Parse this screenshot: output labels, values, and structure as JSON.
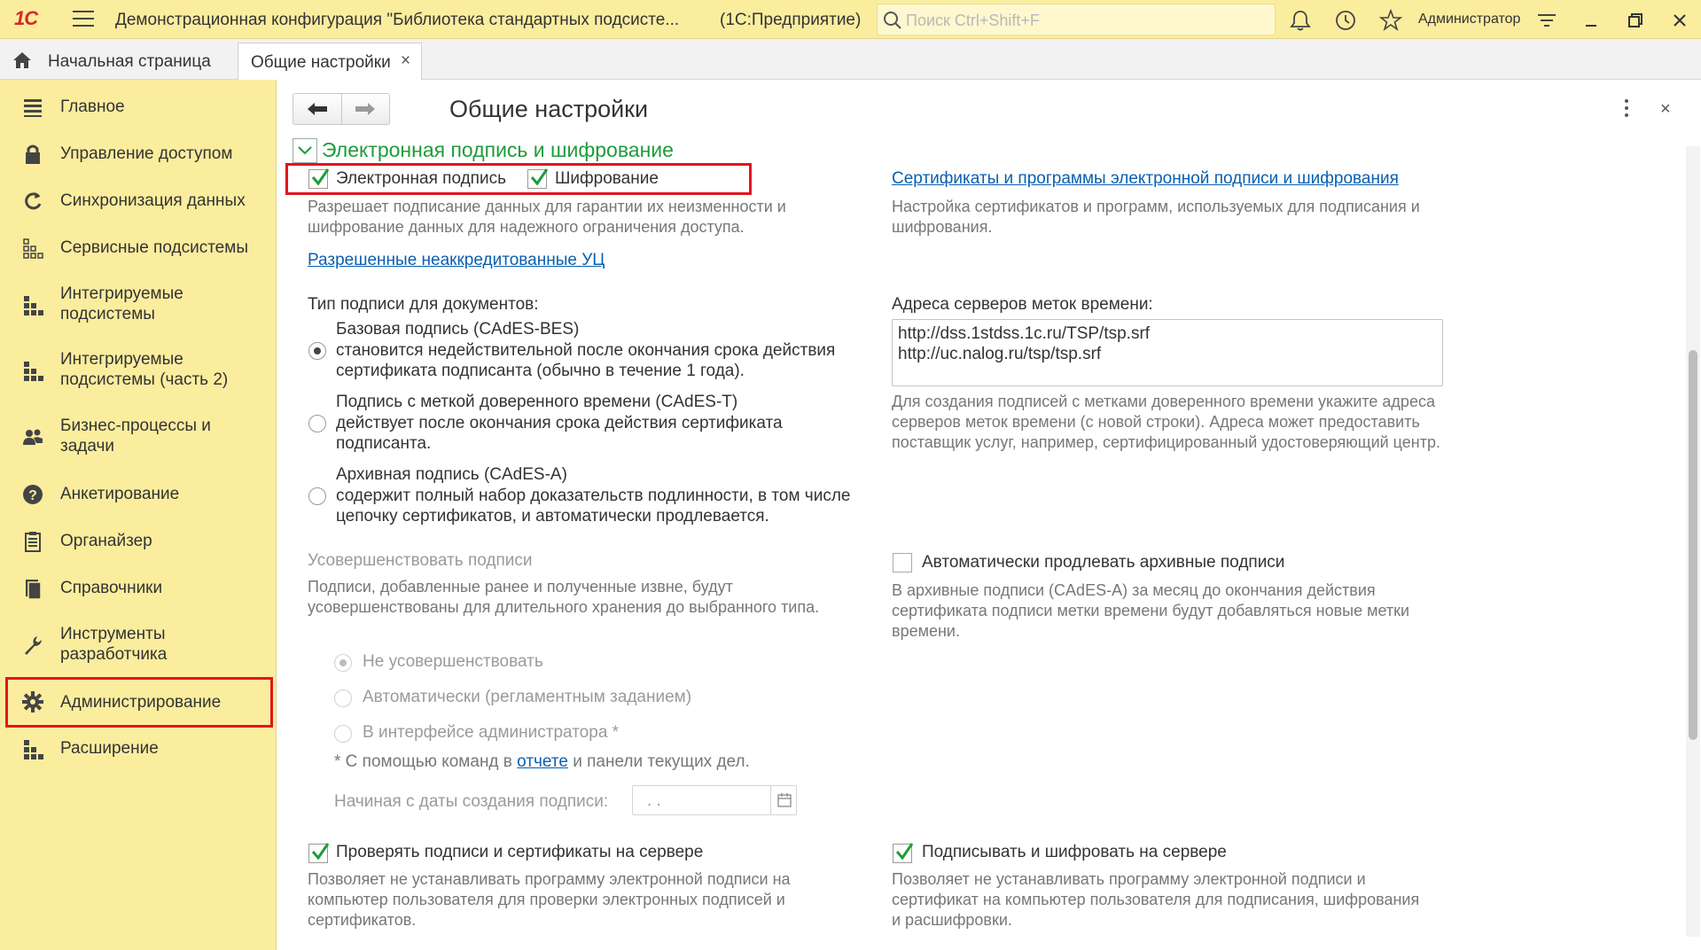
{
  "titlebar": {
    "logo": "1С",
    "title": "Демонстрационная конфигурация \"Библиотека стандартных подсисте...",
    "mode": "(1С:Предприятие)",
    "search_placeholder": "Поиск Ctrl+Shift+F",
    "user": "Администратор"
  },
  "tabs": {
    "home": "Начальная страница",
    "active": "Общие настройки",
    "close_glyph": "×"
  },
  "sidebar": {
    "items": [
      {
        "label": "Главное",
        "icon": "menu-lines-icon"
      },
      {
        "label": "Управление доступом",
        "icon": "lock-icon"
      },
      {
        "label": "Синхронизация данных",
        "icon": "sync-icon"
      },
      {
        "label": "Сервисные подсистемы",
        "icon": "grid-dots-icon"
      },
      {
        "label": "Интегрируемые подсистемы",
        "icon": "blocks-icon"
      },
      {
        "label": "Интегрируемые подсистемы (часть 2)",
        "icon": "blocks-icon"
      },
      {
        "label": "Бизнес-процессы и задачи",
        "icon": "users-icon"
      },
      {
        "label": "Анкетирование",
        "icon": "question-icon"
      },
      {
        "label": "Органайзер",
        "icon": "notepad-icon"
      },
      {
        "label": "Справочники",
        "icon": "books-icon"
      },
      {
        "label": "Инструменты разработчика",
        "icon": "wrench-icon"
      },
      {
        "label": "Администрирование",
        "icon": "gear-icon",
        "active": true
      },
      {
        "label": "Расширение",
        "icon": "blocks-icon"
      }
    ]
  },
  "form": {
    "title": "Общие настройки",
    "group_title": "Электронная подпись и шифрование",
    "cb_signature": "Электронная подпись",
    "cb_encryption": "Шифрование",
    "hint_signature": "Разрешает подписание данных для гарантии их неизменности и шифрование данных для надежного ограничения доступа.",
    "link_ca": "Разрешенные неаккредитованные УЦ",
    "link_certs": "Сертификаты и программы электронной подписи и шифрования",
    "hint_certs": "Настройка сертификатов и программ, используемых для подписания и шифрования.",
    "sig_type_label": "Тип подписи для документов:",
    "sig_types": [
      {
        "title": "Базовая подпись (CAdES-BES)",
        "desc": "становится недействительной после окончания срока действия сертификата подписанта (обычно в течение 1 года).",
        "selected": true
      },
      {
        "title": "Подпись с меткой доверенного времени (CAdES-T)",
        "desc": "действует после окончания срока действия сертификата подписанта.",
        "selected": false
      },
      {
        "title": "Архивная подпись (CAdES-A)",
        "desc": "содержит полный набор доказательств подлинности, в том числе цепочку сертификатов, и автоматически продлевается.",
        "selected": false
      }
    ],
    "timestamp_label": "Адреса серверов меток времени:",
    "timestamp_servers": [
      "http://dss.1stdss.1c.ru/TSP/tsp.srf",
      "http://uc.nalog.ru/tsp/tsp.srf"
    ],
    "timestamp_hint": "Для создания подписей с метками доверенного времени укажите адреса серверов меток времени (с новой строки). Адреса может предоставить поставщик услуг, например, сертифицированный удостоверяющий центр.",
    "improve_label": "Усовершенствовать подписи",
    "improve_hint": "Подписи, добавленные ранее и полученные извне, будут усовершенствованы для длительного хранения до выбранного типа.",
    "improve_options": [
      "Не усовершенствовать",
      "Автоматически (регламентным заданием)",
      "В интерфейсе администратора *"
    ],
    "footnote_prefix": "* С помощью команд в ",
    "footnote_link": "отчете",
    "footnote_suffix": " и панели текущих дел.",
    "start_date_label": "Начиная с даты создания подписи:",
    "start_date_value": " .  .",
    "auto_extend_label": "Автоматически продлевать архивные подписи",
    "auto_extend_hint": "В архивные подписи (CAdES-A) за месяц до окончания действия сертификата подписи метки времени будут добавляться новые метки времени.",
    "check_server_label": "Проверять подписи и сертификаты на сервере",
    "check_server_hint": "Позволяет не устанавливать программу электронной подписи на компьютер пользователя для проверки электронных подписей и сертификатов.",
    "sign_server_label": "Подписывать и шифровать на сервере",
    "sign_server_hint": "Позволяет не устанавливать программу электронной подписи и сертификат на компьютер пользователя для подписания, шифрования и расшифровки."
  },
  "colors": {
    "accent_yellow": "#fbed9e",
    "group_green": "#1f9c3a",
    "link_blue": "#0a5fb0",
    "highlight_red": "#e0161e"
  }
}
